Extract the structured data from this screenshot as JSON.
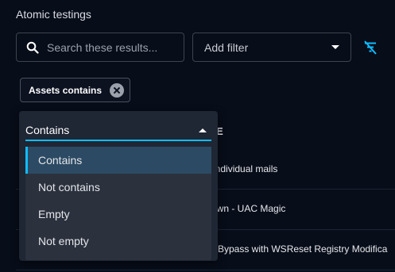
{
  "page": {
    "title": "Atomic testings"
  },
  "search": {
    "placeholder": "Search these results..."
  },
  "filter": {
    "placeholder": "Add filter"
  },
  "chip": {
    "label": "Assets contains"
  },
  "background": {
    "header_fragment": "E",
    "rows": [
      "d individual mails",
      "nPwn - UAC Magic",
      "C Bypass with WSReset Registry Modifica"
    ]
  },
  "operator": {
    "selected": "Contains",
    "options": [
      "Contains",
      "Not contains",
      "Empty",
      "Not empty"
    ]
  },
  "colors": {
    "accent": "#0fbcff",
    "background": "#070d19",
    "menu": "#2b313d"
  },
  "icons": {
    "search": "search-icon",
    "clear_filter": "filter-off-icon",
    "chip_close": "close-circle-icon"
  }
}
